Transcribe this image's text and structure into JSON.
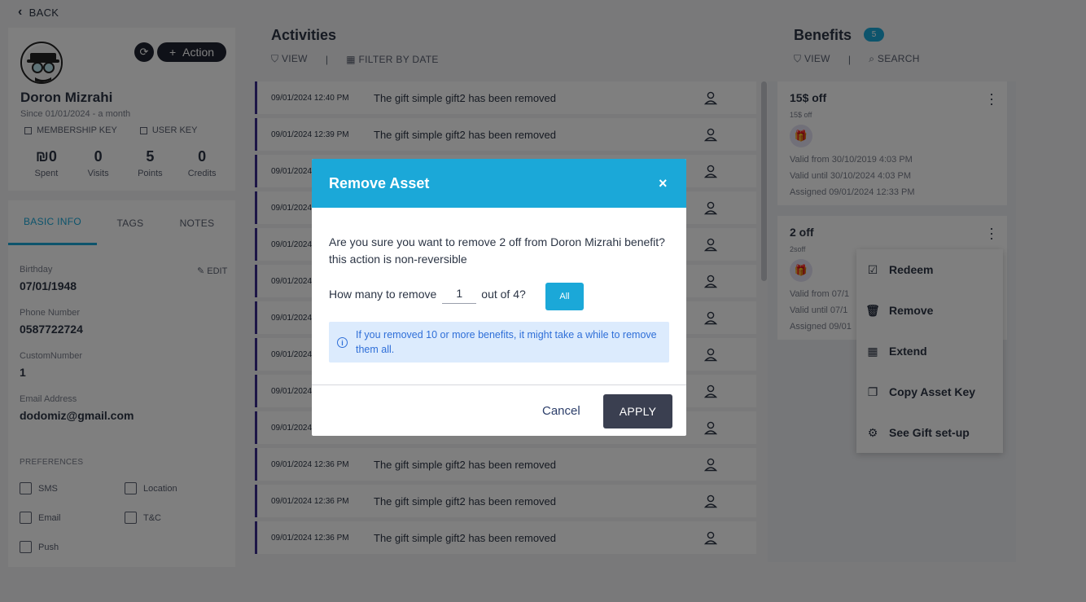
{
  "nav": {
    "back_label": "BACK"
  },
  "profile": {
    "name": "Doron Mizrahi",
    "since": "Since 01/01/2024 - a month",
    "action_label": "Action",
    "membership_key_label": "MEMBERSHIP KEY",
    "user_key_label": "USER KEY",
    "stats": [
      {
        "value": "₪0",
        "label": "Spent"
      },
      {
        "value": "0",
        "label": "Visits"
      },
      {
        "value": "5",
        "label": "Points"
      },
      {
        "value": "0",
        "label": "Credits"
      }
    ]
  },
  "info": {
    "tabs": [
      "BASIC INFO",
      "TAGS",
      "NOTES"
    ],
    "edit_label": "EDIT",
    "fields": [
      {
        "label": "Birthday",
        "value": "07/01/1948"
      },
      {
        "label": "Phone Number",
        "value": "0587722724"
      },
      {
        "label": "CustomNumber",
        "value": "1"
      },
      {
        "label": "Email Address",
        "value": "dodomiz@gmail.com"
      }
    ],
    "preferences_title": "PREFERENCES",
    "preferences": [
      "SMS",
      "Location",
      "Email",
      "T&C",
      "Push"
    ]
  },
  "activities": {
    "title": "Activities",
    "view_label": "VIEW",
    "separator": "|",
    "filter_label": "FILTER BY DATE",
    "rows": [
      {
        "date": "09/01/2024 12:40 PM",
        "text": "The gift simple gift2 has been removed"
      },
      {
        "date": "09/01/2024 12:39 PM",
        "text": "The gift simple gift2 has been removed"
      },
      {
        "date": "09/01/2024",
        "text": ""
      },
      {
        "date": "09/01/2024",
        "text": ""
      },
      {
        "date": "09/01/2024",
        "text": ""
      },
      {
        "date": "09/01/2024",
        "text": ""
      },
      {
        "date": "09/01/2024",
        "text": ""
      },
      {
        "date": "09/01/2024",
        "text": ""
      },
      {
        "date": "09/01/2024",
        "text": ""
      },
      {
        "date": "09/01/2024",
        "text": ""
      },
      {
        "date": "09/01/2024 12:36 PM",
        "text": "The gift simple gift2 has been removed"
      },
      {
        "date": "09/01/2024 12:36 PM",
        "text": "The gift simple gift2 has been removed"
      },
      {
        "date": "09/01/2024 12:36 PM",
        "text": "The gift simple gift2 has been removed"
      }
    ]
  },
  "benefits": {
    "title": "Benefits",
    "count": "5",
    "view_label": "VIEW",
    "separator": "|",
    "search_label": "SEARCH",
    "cards": [
      {
        "title": "15$ off",
        "subtitle": "15$ off",
        "lines": [
          "Valid from 30/10/2019 4:03 PM",
          "Valid until 30/10/2024 4:03 PM",
          "Assigned 09/01/2024 12:33 PM"
        ]
      },
      {
        "title": "2 off",
        "subtitle": "2soff",
        "lines": [
          "Valid from 07/1",
          "Valid until 07/1",
          "Assigned 09/01"
        ]
      }
    ],
    "menu": [
      "Redeem",
      "Remove",
      "Extend",
      "Copy Asset Key",
      "See Gift set-up"
    ]
  },
  "modal": {
    "title": "Remove Asset",
    "close_glyph": "×",
    "message": "Are you sure you want to remove 2 off from Doron Mizrahi benefit? this action is non-reversible",
    "how_many_label": "How many to remove",
    "qty_value": "1",
    "out_of_label": "out of 4?",
    "all_label": "All",
    "notice": "If you removed 10 or more benefits, it might take a while to remove them all.",
    "cancel_label": "Cancel",
    "apply_label": "APPLY"
  },
  "colors": {
    "accent": "#1ba8d8",
    "dark_button": "#3a3f50",
    "activity_bar": "#3b2d8f",
    "notice_bg": "#dcebfd",
    "notice_text": "#2f6fd8"
  }
}
